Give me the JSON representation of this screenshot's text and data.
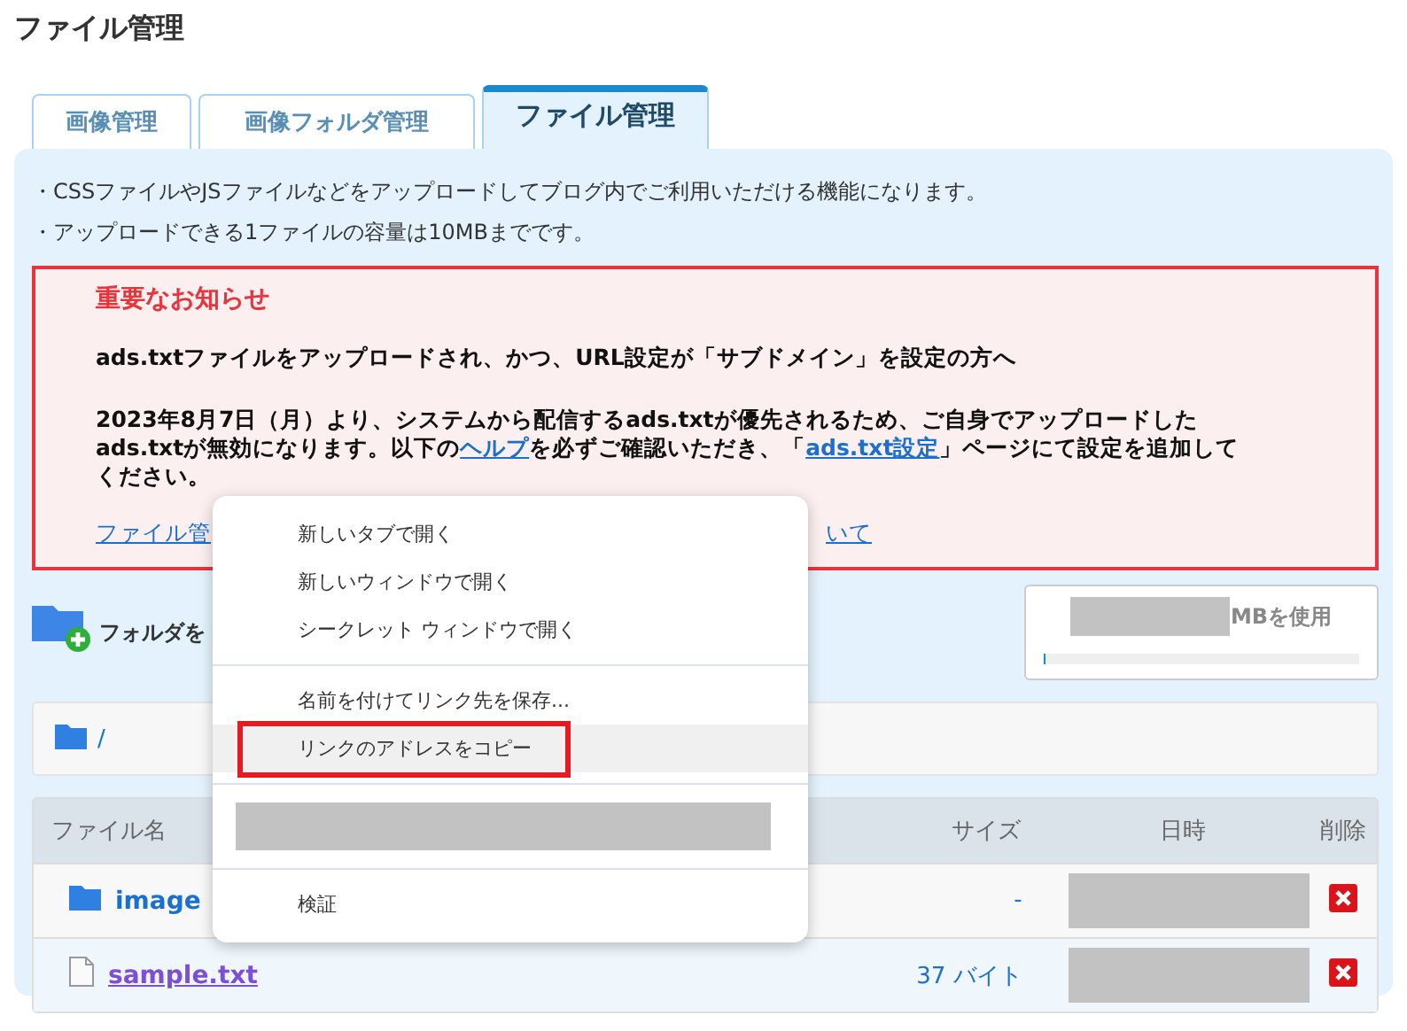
{
  "page_title": "ファイル管理",
  "tabs": [
    {
      "label": "画像管理",
      "selected": false
    },
    {
      "label": "画像フォルダ管理",
      "selected": false
    },
    {
      "label": "ファイル管理",
      "selected": true
    }
  ],
  "notes": [
    "・CSSファイルやJSファイルなどをアップロードしてブログ内でご利用いただける機能になります。",
    "・アップロードできる1ファイルの容量は10MBまでです。"
  ],
  "notice": {
    "heading": "重要なお知らせ",
    "subheading": "ads.txtファイルをアップロードされ、かつ、URL設定が「サブドメイン」を設定の方へ",
    "body": [
      {
        "kind": "text",
        "text": "2023年8月7日（月）より、システムから配信するads.txtが優先されるため、ご自身でアップロードしたads.txtが無効になります。以下の"
      },
      {
        "kind": "link",
        "text": "ヘルプ"
      },
      {
        "kind": "text",
        "text": "を必ずご確認いただき、「"
      },
      {
        "kind": "link",
        "text": "ads.txt設定"
      },
      {
        "kind": "text",
        "text": "」ページにて設定を追加してください。"
      }
    ],
    "link_start": "ファイル管",
    "link_end": "いて"
  },
  "new_folder": {
    "label": "フォルダを"
  },
  "storage": {
    "text": "MBを使用",
    "level": 0.004
  },
  "breadcrumb": "/",
  "table": {
    "columns": [
      "ファイル名",
      "サイズ",
      "日時",
      "削除"
    ],
    "rows": [
      {
        "kind": "folder",
        "name": "image",
        "size": "-"
      },
      {
        "kind": "file",
        "name": "sample.txt",
        "size": "37 バイト"
      }
    ]
  },
  "context_menu": {
    "items": [
      {
        "kind": "item",
        "label": "新しいタブで開く",
        "selected": false,
        "marked": false
      },
      {
        "kind": "item",
        "label": "新しいウィンドウで開く",
        "selected": false,
        "marked": false
      },
      {
        "kind": "item",
        "label": "シークレット ウィンドウで開く",
        "selected": false,
        "marked": false
      },
      {
        "kind": "separator"
      },
      {
        "kind": "item",
        "label": "名前を付けてリンク先を保存...",
        "selected": false,
        "marked": false
      },
      {
        "kind": "item",
        "label": "リンクのアドレスをコピー",
        "selected": true,
        "marked": true
      },
      {
        "kind": "separator"
      },
      {
        "kind": "redacted"
      },
      {
        "kind": "separator"
      },
      {
        "kind": "item",
        "label": "検証",
        "selected": false,
        "marked": false
      }
    ]
  }
}
